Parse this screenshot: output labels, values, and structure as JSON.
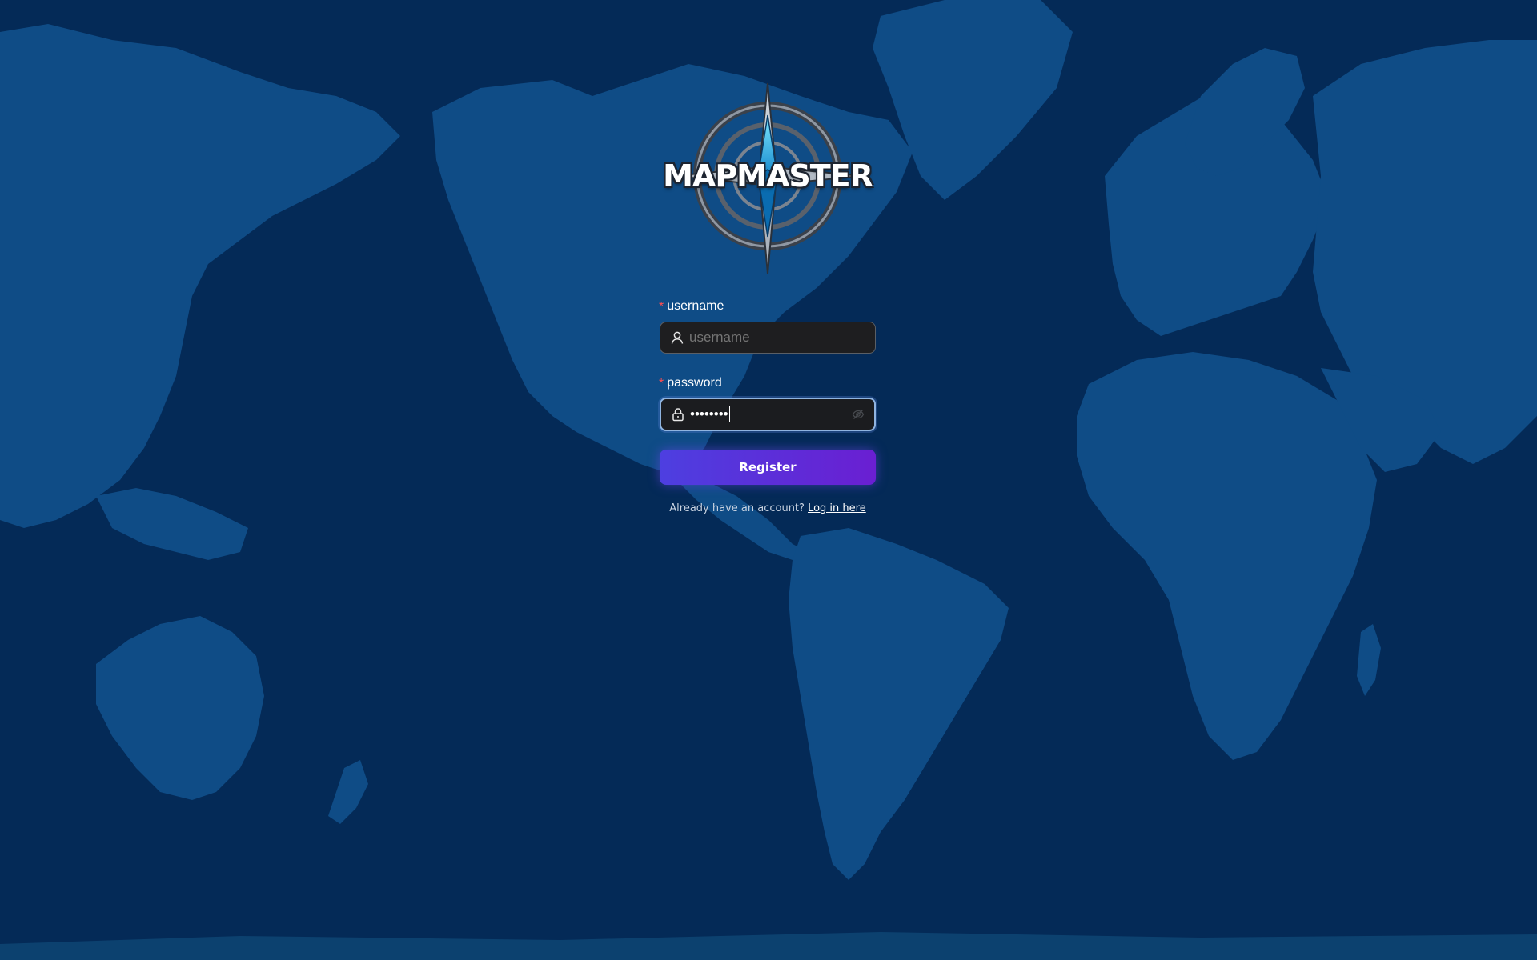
{
  "app": {
    "logo_text": "MAPMASTER",
    "logo_icon": "compass-rose-icon"
  },
  "form": {
    "username": {
      "label": "username",
      "required_mark": "*",
      "placeholder": "username",
      "value": "",
      "icon": "user-icon"
    },
    "password": {
      "label": "password",
      "required_mark": "*",
      "masked_value": "••••••••",
      "icon": "lock-icon",
      "toggle_icon": "eye-slash-icon",
      "focused": true
    },
    "submit_label": "Register",
    "footer_text": "Already have an account?",
    "footer_link": "Log in here"
  },
  "colors": {
    "background": "#042a57",
    "land": "#0f4c86",
    "button_gradient_start": "#4d3fe0",
    "button_gradient_end": "#6a1fd2",
    "required": "#ff4d4f"
  }
}
